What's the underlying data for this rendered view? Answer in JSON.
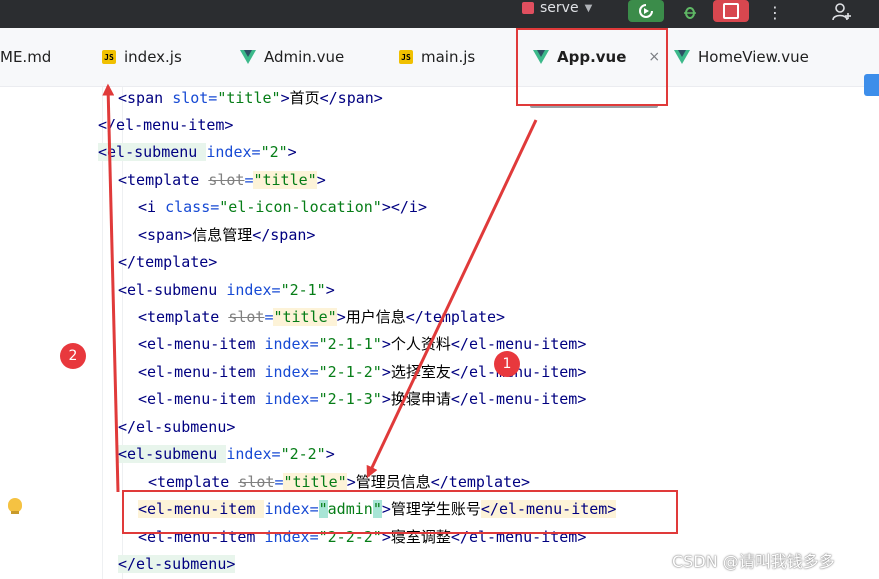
{
  "toolbar": {
    "run_config": "serve",
    "more_label": "⋮"
  },
  "tabs": [
    {
      "label": "ME.md",
      "icon": "markdown-icon"
    },
    {
      "label": "index.js",
      "icon": "js-file-icon"
    },
    {
      "label": "Admin.vue",
      "icon": "vue-file-icon"
    },
    {
      "label": "main.js",
      "icon": "js-file-icon"
    },
    {
      "label": "App.vue",
      "icon": "vue-file-icon",
      "active": true,
      "close": "×"
    },
    {
      "label": "HomeView.vue",
      "icon": "vue-file-icon"
    }
  ],
  "js_badge": "JS",
  "code": {
    "l1_open": "<span ",
    "l1_attr": "slot=",
    "l1_val": "\"title\"",
    "l1_close": ">",
    "l1_text": "首页",
    "l1_end": "</span>",
    "l2": "</el-menu-item>",
    "l3_open": "<el-submenu ",
    "l3_attr": "index=",
    "l3_val": "\"2\"",
    "l3_close": ">",
    "l4_open": "<template ",
    "l4_attr": "slot",
    "l4_eq": "=",
    "l4_val": "\"title\"",
    "l4_close": ">",
    "l5_open": "<i ",
    "l5_attr": "class=",
    "l5_val": "\"el-icon-location\"",
    "l5_close": "></i>",
    "l6_open": "<span>",
    "l6_text": "信息管理",
    "l6_end": "</span>",
    "l7": "</template>",
    "l8_open": "<el-submenu ",
    "l8_attr": "index=",
    "l8_val": "\"2-1\"",
    "l8_close": ">",
    "l9_open": "<template ",
    "l9_attr": "slot",
    "l9_eq": "=",
    "l9_val": "\"title\"",
    "l9_close": ">",
    "l9_text": "用户信息",
    "l9_end": "</template>",
    "l10_open": "<el-menu-item ",
    "l10_attr": "index=",
    "l10_val": "\"2-1-1\"",
    "l10_close": ">",
    "l10_text": "个人资料",
    "l10_end": "</el-menu-item>",
    "l11_open": "<el-menu-item ",
    "l11_attr": "index=",
    "l11_val": "\"2-1-2\"",
    "l11_close": ">",
    "l11_text": "选择室友",
    "l11_end": "</el-menu-item>",
    "l12_open": "<el-menu-item ",
    "l12_attr": "index=",
    "l12_val": "\"2-1-3\"",
    "l12_close": ">",
    "l12_text": "换寝申请",
    "l12_end": "</el-menu-item>",
    "l13": "</el-submenu>",
    "l14_open": "<el-submenu ",
    "l14_attr": "index=",
    "l14_val": "\"2-2\"",
    "l14_close": ">",
    "l15_open": "<template ",
    "l15_attr": "slot",
    "l15_eq": "=",
    "l15_val": "\"title\"",
    "l15_close": ">",
    "l15_text": "管理员信息",
    "l15_end": "</template>",
    "l16_open": "<el-menu-item ",
    "l16_attr": "index=",
    "l16_q1": "\"",
    "l16_val": "admin",
    "l16_q2": "\"",
    "l16_close": ">",
    "l16_text": "管理学生账号",
    "l16_end": "</el-menu-item>",
    "l17_open": "<el-menu-item ",
    "l17_attr": "index=",
    "l17_val": "\"2-2-2\"",
    "l17_close": ">",
    "l17_text": "寝室调整",
    "l17_end": "</el-menu-item>",
    "l18": "</el-submenu>"
  },
  "annotations": {
    "badge_1": "1",
    "badge_2": "2",
    "color": "#e03a3a"
  },
  "watermark": "CSDN @请叫我钱多多"
}
